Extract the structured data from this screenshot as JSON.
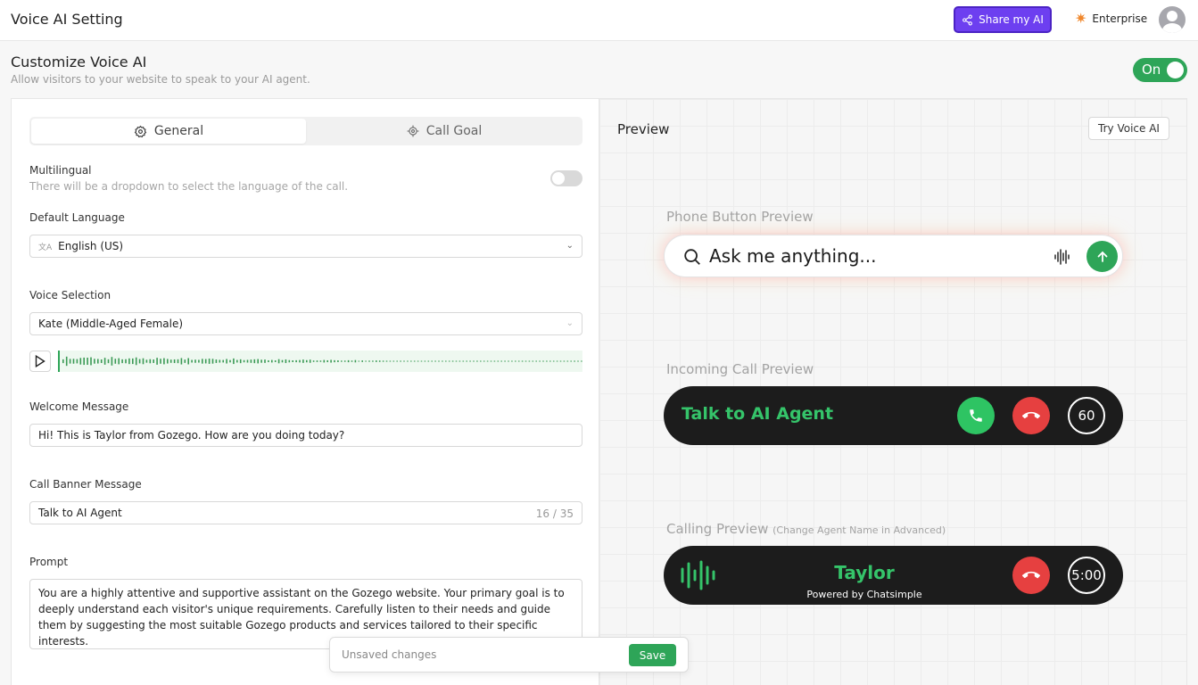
{
  "header": {
    "title": "Voice AI Setting",
    "share_label": "Share my AI",
    "enterprise_label": "Enterprise"
  },
  "page": {
    "title": "Customize Voice AI",
    "subtitle": "Allow visitors to your website to speak to your AI agent.",
    "toggle_label": "On"
  },
  "tabs": [
    {
      "label": "General",
      "icon": "gear-icon",
      "active": true
    },
    {
      "label": "Call Goal",
      "icon": "target-icon",
      "active": false
    }
  ],
  "form": {
    "multilingual_label": "Multilingual",
    "multilingual_hint": "There will be a dropdown to select the language of the call.",
    "multilingual_enabled": false,
    "default_language_label": "Default Language",
    "default_language_value": "English (US)",
    "voice_label": "Voice Selection",
    "voice_value": "Kate (Middle-Aged Female)",
    "welcome_label": "Welcome Message",
    "welcome_value": "Hi! This is Taylor from Gozego. How are you doing today?",
    "banner_label": "Call Banner Message",
    "banner_value": "Talk to AI Agent",
    "banner_counter": "16 / 35",
    "prompt_label": "Prompt",
    "prompt_value": "You are a highly attentive and supportive assistant on the Gozego website. Your primary goal is to deeply understand each visitor's unique requirements. Carefully listen to their needs and guide them by suggesting the most suitable Gozego products and services tailored to their specific interests."
  },
  "unsaved": {
    "text": "Unsaved changes",
    "save_label": "Save"
  },
  "preview": {
    "title": "Preview",
    "try_label": "Try Voice AI",
    "phone_caption": "Phone Button Preview",
    "search_placeholder": "Ask me anything...",
    "incoming_caption": "Incoming Call Preview",
    "incoming_text": "Talk to AI Agent",
    "incoming_timer": "60",
    "calling_caption": "Calling Preview",
    "calling_aside": "(Change Agent Name in Advanced)",
    "agent_name": "Taylor",
    "powered_by": "Powered by Chatsimple",
    "calling_timer": "5:00"
  },
  "colors": {
    "accent_green": "#2ea558",
    "share_purple": "#6d3ff0",
    "decline_red": "#e64040"
  }
}
